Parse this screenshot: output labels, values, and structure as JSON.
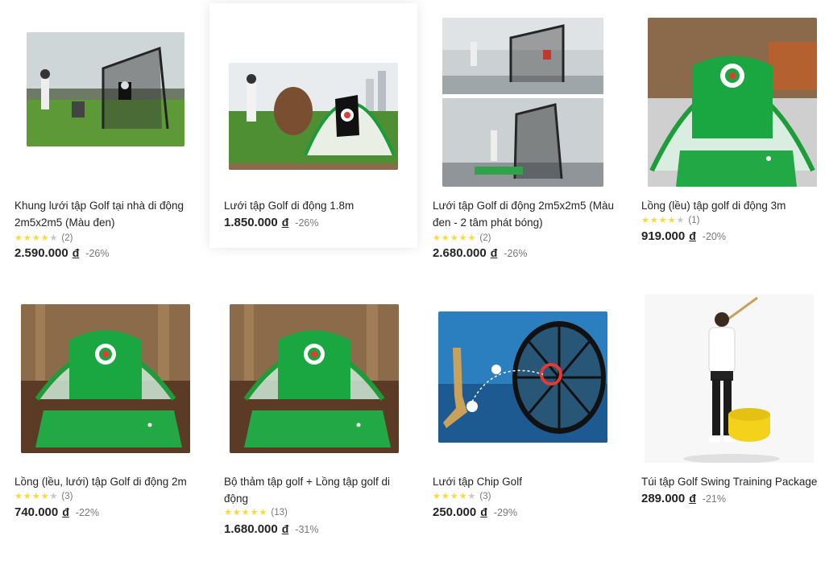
{
  "currency_symbol": "đ",
  "colors": {
    "star_on": "#fdd836",
    "star_off": "#c7c7c7",
    "text": "#242424",
    "muted": "#787878"
  },
  "products": [
    {
      "name": "Khung lưới tập Golf tại nhà di động 2m5x2m5 (Màu đen)",
      "rating": 4,
      "review_count": "(2)",
      "price": "2.590.000",
      "discount": "-26%",
      "image_icon": "black-golf-net-photo"
    },
    {
      "name": "Lưới tập Golf di động 1.8m",
      "rating": 0,
      "review_count": "",
      "price": "1.850.000",
      "discount": "-26%",
      "image_icon": "white-green-golf-net-photo"
    },
    {
      "name": "Lưới tập Golf di động 2m5x2m5 (Màu đen - 2 tâm phát bóng)",
      "rating": 4.5,
      "review_count": "(2)",
      "price": "2.680.000",
      "discount": "-26%",
      "image_icon": "golf-net-collage-photo"
    },
    {
      "name": "Lồng (lều) tập golf di động 3m",
      "rating": 4,
      "review_count": "(1)",
      "price": "919.000",
      "discount": "-20%",
      "image_icon": "green-golf-tent-photo"
    },
    {
      "name": "Lồng (lều, lưới) tập Golf di động 2m",
      "rating": 4,
      "review_count": "(3)",
      "price": "740.000",
      "discount": "-22%",
      "image_icon": "golf-tent-mat-photo"
    },
    {
      "name": "Bộ thảm tập golf + Lồng tập golf di động",
      "rating": 5,
      "review_count": "(13)",
      "price": "1.680.000",
      "discount": "-31%",
      "image_icon": "golf-tent-mat-photo"
    },
    {
      "name": "Lưới tập Chip Golf",
      "rating": 3.5,
      "review_count": "(3)",
      "price": "250.000",
      "discount": "-29%",
      "image_icon": "chip-net-photo"
    },
    {
      "name": "Túi tập Golf Swing Training Package",
      "rating": 0,
      "review_count": "",
      "price": "289.000",
      "discount": "-21%",
      "image_icon": "golfer-swing-bag-photo"
    }
  ]
}
